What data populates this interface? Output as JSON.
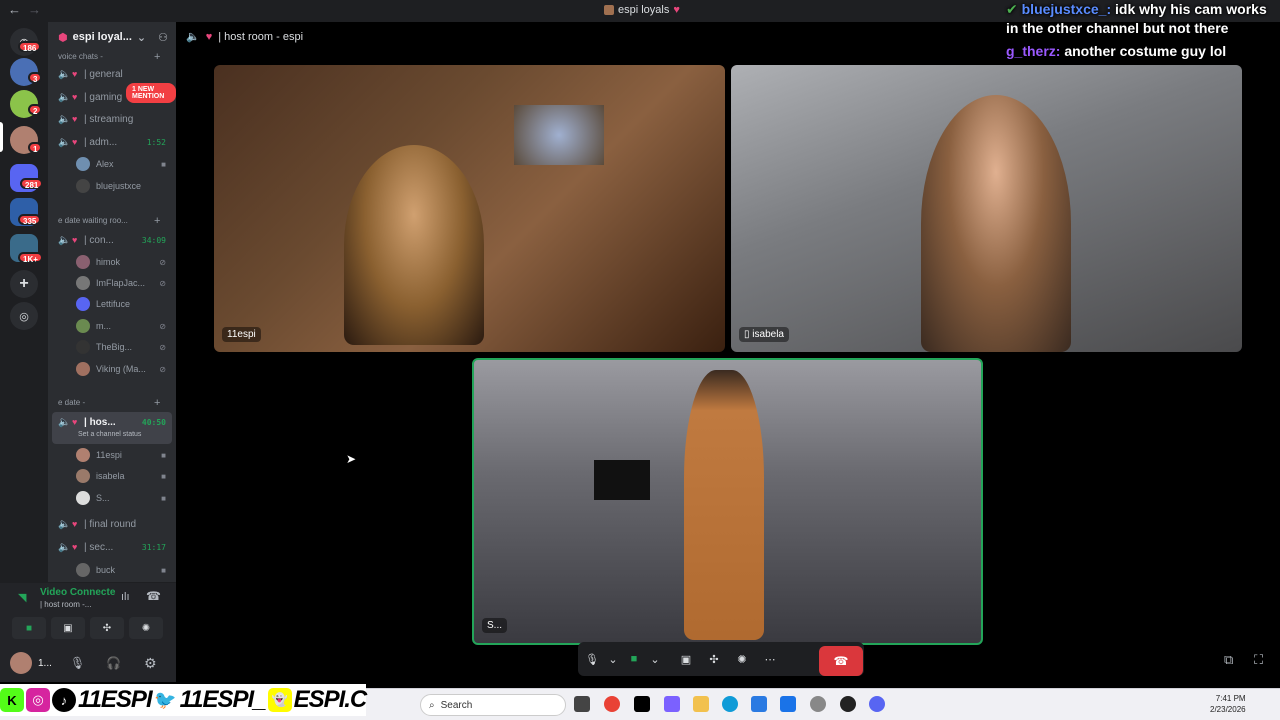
{
  "window": {
    "title": "espi loyals"
  },
  "guilds": [
    {
      "badge": "186"
    },
    {
      "badge": "3"
    },
    {
      "badge": "2"
    },
    {
      "badge": "1"
    },
    {
      "badge": "281"
    },
    {
      "badge": "335"
    },
    {
      "badge": "1K+"
    }
  ],
  "server": {
    "name": "espi loyal..."
  },
  "sidebar": {
    "mention_badge": "1 NEW MENTION",
    "voice_chats_category": "voice chats -",
    "channels_top": [
      {
        "name": "| general"
      },
      {
        "name": "| gaming"
      },
      {
        "name": "| streaming"
      },
      {
        "name": "| adm...",
        "time": "1:52"
      }
    ],
    "admin_users": [
      {
        "name": "Alex"
      },
      {
        "name": "bluejustxce"
      }
    ],
    "waiting_category": "e date waiting roo...",
    "waiting_channel": {
      "name": "| con...",
      "time": "34:09"
    },
    "waiting_users": [
      {
        "name": "himok"
      },
      {
        "name": "ImFlapJac..."
      },
      {
        "name": "Lettifuce"
      },
      {
        "name": "m..."
      },
      {
        "name": "TheBig..."
      },
      {
        "name": "Viking (Ma..."
      }
    ],
    "date_category": "e date -",
    "host_channel": {
      "name": "| hos...",
      "time": "40:50",
      "status": "Set a channel status"
    },
    "host_users": [
      {
        "name": "11espi"
      },
      {
        "name": "isabela"
      },
      {
        "name": "S..."
      }
    ],
    "bottom_channels": [
      {
        "name": "| final round"
      },
      {
        "name": "| sec...",
        "time": "31:17"
      }
    ],
    "bottom_user": {
      "name": "buck"
    }
  },
  "voice_panel": {
    "status": "Video Connecte",
    "sub": "| host room -..."
  },
  "user_bar": {
    "name": "1..."
  },
  "call": {
    "header": "| host room - espi",
    "tiles": [
      {
        "name": "11espi"
      },
      {
        "name": "isabela"
      },
      {
        "name": "S..."
      }
    ]
  },
  "chat_overlay": {
    "messages": [
      {
        "user": "bluejustxce_:",
        "text": "idk why his cam works in the other channel but not there"
      },
      {
        "user": "g_therz:",
        "text": "another costume guy lol"
      }
    ]
  },
  "stream_overlay": {
    "handle1": "11ESPI",
    "handle2": "11ESPI_",
    "handle3": "ESPI.C"
  },
  "taskbar": {
    "search_placeholder": "Search",
    "time": "7:41 PM",
    "date": "2/23/2026"
  },
  "colors": {
    "accent_green": "#23a559",
    "hangup_red": "#da373c",
    "mention_red": "#f23f43"
  }
}
